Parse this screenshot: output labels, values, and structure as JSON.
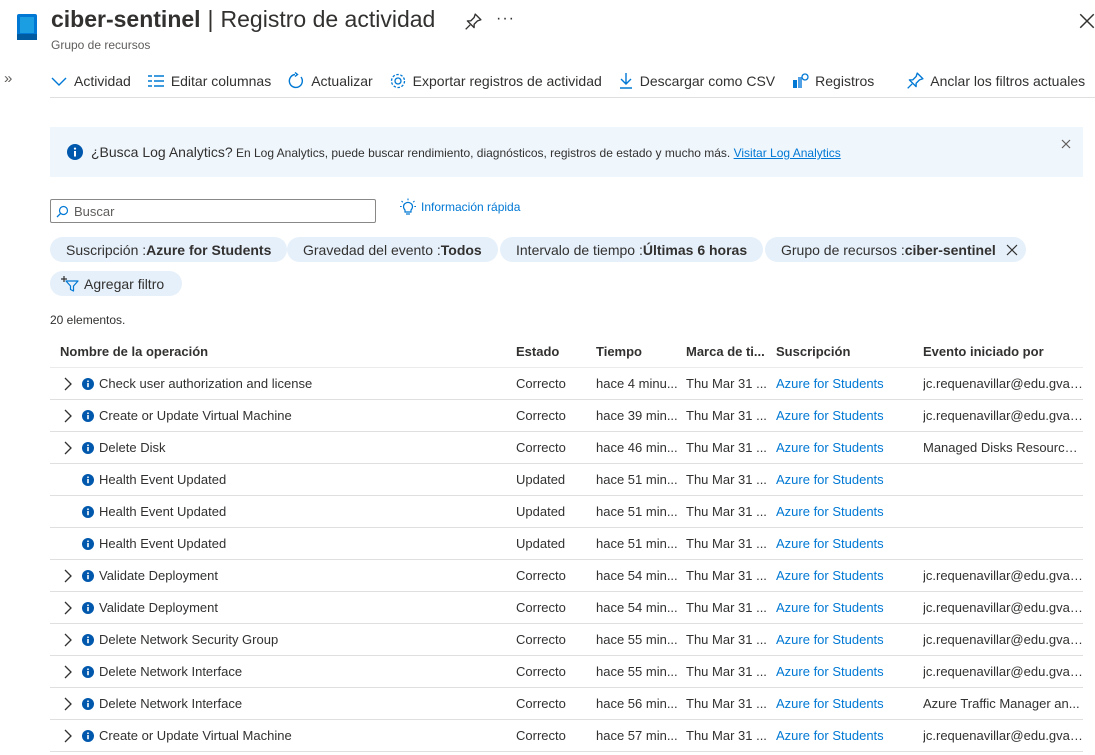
{
  "header": {
    "resource_name": "ciber-sentinel",
    "separator": "|",
    "page_title": "Registro de actividad",
    "subtitle": "Grupo de recursos"
  },
  "toolbar": {
    "items": [
      {
        "label": "Actividad",
        "icon": "chevron-down-icon"
      },
      {
        "label": "Editar columnas",
        "icon": "columns-icon"
      },
      {
        "label": "Actualizar",
        "icon": "refresh-icon"
      },
      {
        "label": "Exportar registros de actividad",
        "icon": "gear-icon"
      },
      {
        "label": "Descargar como CSV",
        "icon": "download-icon"
      },
      {
        "label": "Registros",
        "icon": "logs-icon"
      },
      {
        "label": "Anclar los filtros actuales",
        "icon": "pin-icon"
      }
    ],
    "more": "···"
  },
  "banner": {
    "strong": "¿Busca Log Analytics?",
    "text": " En Log Analytics, puede buscar rendimiento, diagnósticos, registros de estado y mucho más. ",
    "link": "Visitar Log Analytics"
  },
  "search": {
    "placeholder": "Buscar",
    "value": ""
  },
  "quick_info": "Información rápida",
  "filters": [
    {
      "key": "Suscripción : ",
      "value": "Azure for Students",
      "closable": false
    },
    {
      "key": "Gravedad del evento : ",
      "value": "Todos",
      "closable": false
    },
    {
      "key": "Intervalo de tiempo : ",
      "value": "Últimas 6 horas",
      "closable": false
    },
    {
      "key": "Grupo de recursos : ",
      "value": "ciber-sentinel",
      "closable": true
    }
  ],
  "add_filter": "Agregar filtro",
  "count_text": "20 elementos.",
  "colors": {
    "accent": "#0078d4",
    "pill_bg": "#e6f0fa",
    "banner_bg": "#eff6fc"
  },
  "table": {
    "headers": [
      "Nombre de la operación",
      "Estado",
      "Tiempo",
      "Marca de ti...",
      "Suscripción",
      "Evento iniciado por"
    ],
    "rows": [
      {
        "expandable": true,
        "name": "Check user authorization and license",
        "state": "Correcto",
        "time": "hace 4 minu...",
        "mark": "Thu Mar 31 ...",
        "sub": "Azure for Students",
        "by": "jc.requenavillar@edu.gva.es"
      },
      {
        "expandable": true,
        "name": "Create or Update Virtual Machine",
        "state": "Correcto",
        "time": "hace 39 min...",
        "mark": "Thu Mar 31 ...",
        "sub": "Azure for Students",
        "by": "jc.requenavillar@edu.gva.es"
      },
      {
        "expandable": true,
        "name": "Delete Disk",
        "state": "Correcto",
        "time": "hace 46 min...",
        "mark": "Thu Mar 31 ...",
        "sub": "Azure for Students",
        "by": "Managed Disks Resource ..."
      },
      {
        "expandable": false,
        "name": "Health Event Updated",
        "state": "Updated",
        "time": "hace 51 min...",
        "mark": "Thu Mar 31 ...",
        "sub": "Azure for Students",
        "by": ""
      },
      {
        "expandable": false,
        "name": "Health Event Updated",
        "state": "Updated",
        "time": "hace 51 min...",
        "mark": "Thu Mar 31 ...",
        "sub": "Azure for Students",
        "by": ""
      },
      {
        "expandable": false,
        "name": "Health Event Updated",
        "state": "Updated",
        "time": "hace 51 min...",
        "mark": "Thu Mar 31 ...",
        "sub": "Azure for Students",
        "by": ""
      },
      {
        "expandable": true,
        "name": "Validate Deployment",
        "state": "Correcto",
        "time": "hace 54 min...",
        "mark": "Thu Mar 31 ...",
        "sub": "Azure for Students",
        "by": "jc.requenavillar@edu.gva.es"
      },
      {
        "expandable": true,
        "name": "Validate Deployment",
        "state": "Correcto",
        "time": "hace 54 min...",
        "mark": "Thu Mar 31 ...",
        "sub": "Azure for Students",
        "by": "jc.requenavillar@edu.gva.es"
      },
      {
        "expandable": true,
        "name": "Delete Network Security Group",
        "state": "Correcto",
        "time": "hace 55 min...",
        "mark": "Thu Mar 31 ...",
        "sub": "Azure for Students",
        "by": "jc.requenavillar@edu.gva.es"
      },
      {
        "expandable": true,
        "name": "Delete Network Interface",
        "state": "Correcto",
        "time": "hace 55 min...",
        "mark": "Thu Mar 31 ...",
        "sub": "Azure for Students",
        "by": "jc.requenavillar@edu.gva.es"
      },
      {
        "expandable": true,
        "name": "Delete Network Interface",
        "state": "Correcto",
        "time": "hace 56 min...",
        "mark": "Thu Mar 31 ...",
        "sub": "Azure for Students",
        "by": "Azure Traffic Manager an..."
      },
      {
        "expandable": true,
        "name": "Create or Update Virtual Machine",
        "state": "Correcto",
        "time": "hace 57 min...",
        "mark": "Thu Mar 31 ...",
        "sub": "Azure for Students",
        "by": "jc.requenavillar@edu.gva.es"
      }
    ]
  }
}
